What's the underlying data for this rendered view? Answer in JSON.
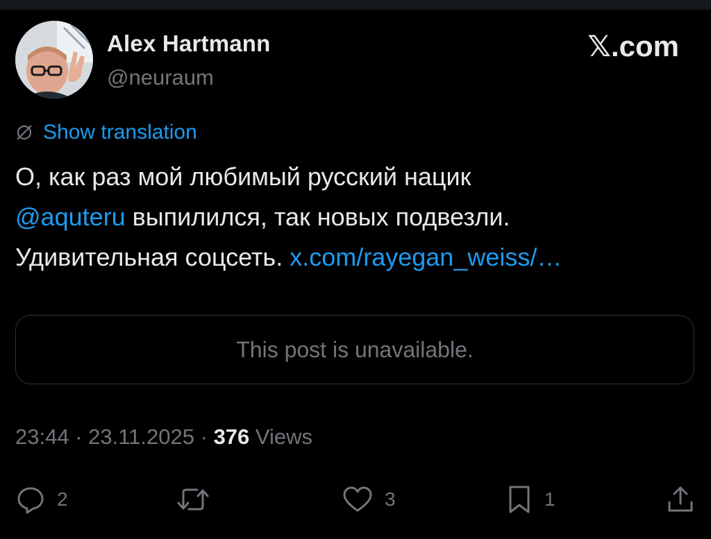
{
  "author": {
    "display_name": "Alex Hartmann",
    "handle": "@neuraum"
  },
  "brand": {
    "logo_text": "𝕏",
    "domain_text": ".com"
  },
  "translation": {
    "label": "Show translation",
    "icon": "globe-slash-icon"
  },
  "post": {
    "text_part1": "О, как раз мой любимый русский нацик",
    "mention": "@aquteru",
    "text_part2": " выпилился, так новых подвезли.",
    "text_part3": "Удивительная соцсеть. ",
    "link": "x.com/rayegan_weiss/…"
  },
  "quoted": {
    "message": "This post is unavailable."
  },
  "meta": {
    "time": "23:44",
    "date": "23.11.2025",
    "separator": " · ",
    "views_count": "376",
    "views_label": " Views"
  },
  "actions": {
    "replies": "2",
    "reposts": "",
    "likes": "3",
    "bookmarks": "1"
  },
  "colors": {
    "background": "#000000",
    "text": "#e7e9ea",
    "muted": "#71767b",
    "accent": "#1d9bf0",
    "border": "#2f3336"
  }
}
